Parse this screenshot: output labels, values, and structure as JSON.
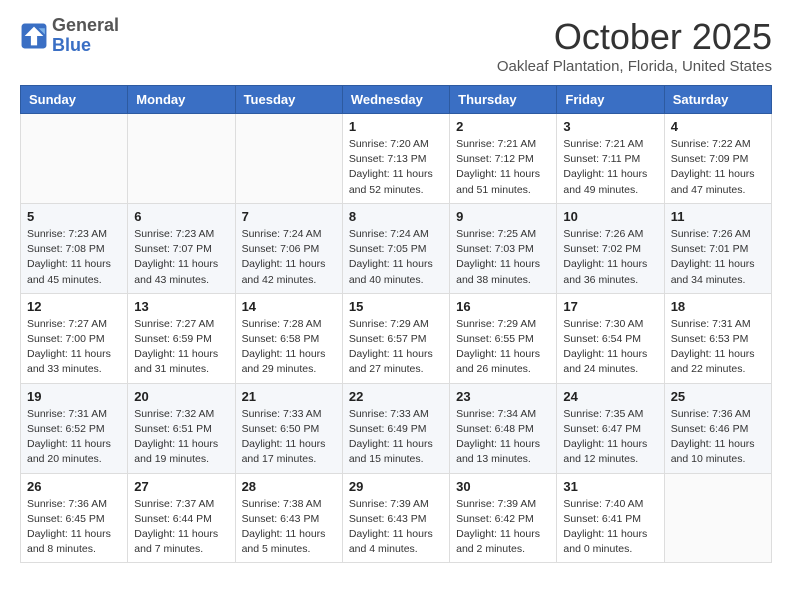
{
  "logo": {
    "general": "General",
    "blue": "Blue"
  },
  "header": {
    "month": "October 2025",
    "location": "Oakleaf Plantation, Florida, United States"
  },
  "days_of_week": [
    "Sunday",
    "Monday",
    "Tuesday",
    "Wednesday",
    "Thursday",
    "Friday",
    "Saturday"
  ],
  "weeks": [
    [
      {
        "day": "",
        "info": ""
      },
      {
        "day": "",
        "info": ""
      },
      {
        "day": "",
        "info": ""
      },
      {
        "day": "1",
        "info": "Sunrise: 7:20 AM\nSunset: 7:13 PM\nDaylight: 11 hours\nand 52 minutes."
      },
      {
        "day": "2",
        "info": "Sunrise: 7:21 AM\nSunset: 7:12 PM\nDaylight: 11 hours\nand 51 minutes."
      },
      {
        "day": "3",
        "info": "Sunrise: 7:21 AM\nSunset: 7:11 PM\nDaylight: 11 hours\nand 49 minutes."
      },
      {
        "day": "4",
        "info": "Sunrise: 7:22 AM\nSunset: 7:09 PM\nDaylight: 11 hours\nand 47 minutes."
      }
    ],
    [
      {
        "day": "5",
        "info": "Sunrise: 7:23 AM\nSunset: 7:08 PM\nDaylight: 11 hours\nand 45 minutes."
      },
      {
        "day": "6",
        "info": "Sunrise: 7:23 AM\nSunset: 7:07 PM\nDaylight: 11 hours\nand 43 minutes."
      },
      {
        "day": "7",
        "info": "Sunrise: 7:24 AM\nSunset: 7:06 PM\nDaylight: 11 hours\nand 42 minutes."
      },
      {
        "day": "8",
        "info": "Sunrise: 7:24 AM\nSunset: 7:05 PM\nDaylight: 11 hours\nand 40 minutes."
      },
      {
        "day": "9",
        "info": "Sunrise: 7:25 AM\nSunset: 7:03 PM\nDaylight: 11 hours\nand 38 minutes."
      },
      {
        "day": "10",
        "info": "Sunrise: 7:26 AM\nSunset: 7:02 PM\nDaylight: 11 hours\nand 36 minutes."
      },
      {
        "day": "11",
        "info": "Sunrise: 7:26 AM\nSunset: 7:01 PM\nDaylight: 11 hours\nand 34 minutes."
      }
    ],
    [
      {
        "day": "12",
        "info": "Sunrise: 7:27 AM\nSunset: 7:00 PM\nDaylight: 11 hours\nand 33 minutes."
      },
      {
        "day": "13",
        "info": "Sunrise: 7:27 AM\nSunset: 6:59 PM\nDaylight: 11 hours\nand 31 minutes."
      },
      {
        "day": "14",
        "info": "Sunrise: 7:28 AM\nSunset: 6:58 PM\nDaylight: 11 hours\nand 29 minutes."
      },
      {
        "day": "15",
        "info": "Sunrise: 7:29 AM\nSunset: 6:57 PM\nDaylight: 11 hours\nand 27 minutes."
      },
      {
        "day": "16",
        "info": "Sunrise: 7:29 AM\nSunset: 6:55 PM\nDaylight: 11 hours\nand 26 minutes."
      },
      {
        "day": "17",
        "info": "Sunrise: 7:30 AM\nSunset: 6:54 PM\nDaylight: 11 hours\nand 24 minutes."
      },
      {
        "day": "18",
        "info": "Sunrise: 7:31 AM\nSunset: 6:53 PM\nDaylight: 11 hours\nand 22 minutes."
      }
    ],
    [
      {
        "day": "19",
        "info": "Sunrise: 7:31 AM\nSunset: 6:52 PM\nDaylight: 11 hours\nand 20 minutes."
      },
      {
        "day": "20",
        "info": "Sunrise: 7:32 AM\nSunset: 6:51 PM\nDaylight: 11 hours\nand 19 minutes."
      },
      {
        "day": "21",
        "info": "Sunrise: 7:33 AM\nSunset: 6:50 PM\nDaylight: 11 hours\nand 17 minutes."
      },
      {
        "day": "22",
        "info": "Sunrise: 7:33 AM\nSunset: 6:49 PM\nDaylight: 11 hours\nand 15 minutes."
      },
      {
        "day": "23",
        "info": "Sunrise: 7:34 AM\nSunset: 6:48 PM\nDaylight: 11 hours\nand 13 minutes."
      },
      {
        "day": "24",
        "info": "Sunrise: 7:35 AM\nSunset: 6:47 PM\nDaylight: 11 hours\nand 12 minutes."
      },
      {
        "day": "25",
        "info": "Sunrise: 7:36 AM\nSunset: 6:46 PM\nDaylight: 11 hours\nand 10 minutes."
      }
    ],
    [
      {
        "day": "26",
        "info": "Sunrise: 7:36 AM\nSunset: 6:45 PM\nDaylight: 11 hours\nand 8 minutes."
      },
      {
        "day": "27",
        "info": "Sunrise: 7:37 AM\nSunset: 6:44 PM\nDaylight: 11 hours\nand 7 minutes."
      },
      {
        "day": "28",
        "info": "Sunrise: 7:38 AM\nSunset: 6:43 PM\nDaylight: 11 hours\nand 5 minutes."
      },
      {
        "day": "29",
        "info": "Sunrise: 7:39 AM\nSunset: 6:43 PM\nDaylight: 11 hours\nand 4 minutes."
      },
      {
        "day": "30",
        "info": "Sunrise: 7:39 AM\nSunset: 6:42 PM\nDaylight: 11 hours\nand 2 minutes."
      },
      {
        "day": "31",
        "info": "Sunrise: 7:40 AM\nSunset: 6:41 PM\nDaylight: 11 hours\nand 0 minutes."
      },
      {
        "day": "",
        "info": ""
      }
    ]
  ]
}
